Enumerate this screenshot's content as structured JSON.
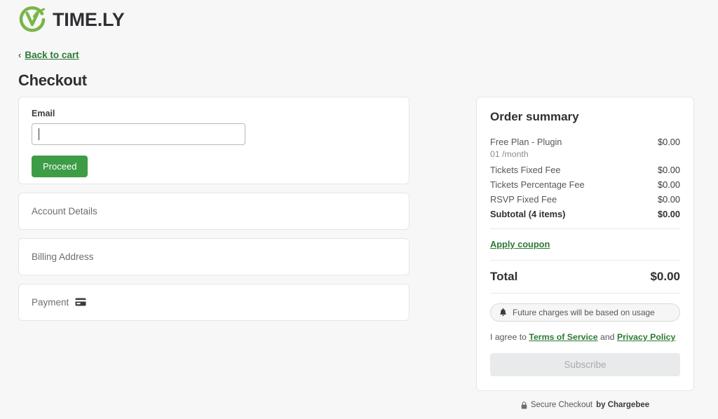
{
  "brand": {
    "wordmark": "TIME.LY",
    "logo_icon": "timely-check-circle-icon",
    "accent_green": "#7ab648"
  },
  "nav": {
    "back_label": "Back to cart",
    "back_chevron_icon": "chevron-left-icon"
  },
  "header": {
    "title": "Checkout"
  },
  "form": {
    "email": {
      "label": "Email",
      "value": "",
      "placeholder": ""
    },
    "proceed_label": "Proceed",
    "sections": [
      {
        "title": "Account Details",
        "icon": null
      },
      {
        "title": "Billing Address",
        "icon": null
      },
      {
        "title": "Payment",
        "icon": "credit-card-icon"
      }
    ]
  },
  "summary": {
    "title": "Order summary",
    "items": [
      {
        "name": "Free Plan - Plugin",
        "sub": "01 /month",
        "amount": "$0.00"
      },
      {
        "name": "Tickets Fixed Fee",
        "sub": null,
        "amount": "$0.00"
      },
      {
        "name": "Tickets Percentage Fee",
        "sub": null,
        "amount": "$0.00"
      },
      {
        "name": "RSVP Fixed Fee",
        "sub": null,
        "amount": "$0.00"
      }
    ],
    "subtotal": {
      "label": "Subtotal (4 items)",
      "amount": "$0.00"
    },
    "coupon_label": "Apply coupon",
    "total": {
      "label": "Total",
      "amount": "$0.00"
    },
    "notice": {
      "icon": "bell-icon",
      "text": "Future charges will be based on usage"
    },
    "agreement": {
      "prefix": "I agree to ",
      "terms_label": "Terms of Service",
      "conjunction": " and ",
      "privacy_label": "Privacy Policy"
    },
    "subscribe_label": "Subscribe"
  },
  "footer": {
    "lock_icon": "lock-icon",
    "text": "Secure Checkout ",
    "provider": "by Chargebee"
  },
  "colors": {
    "link_green": "#2c7a33",
    "button_green": "#3d9c46",
    "page_bg": "#f7f7f7"
  }
}
